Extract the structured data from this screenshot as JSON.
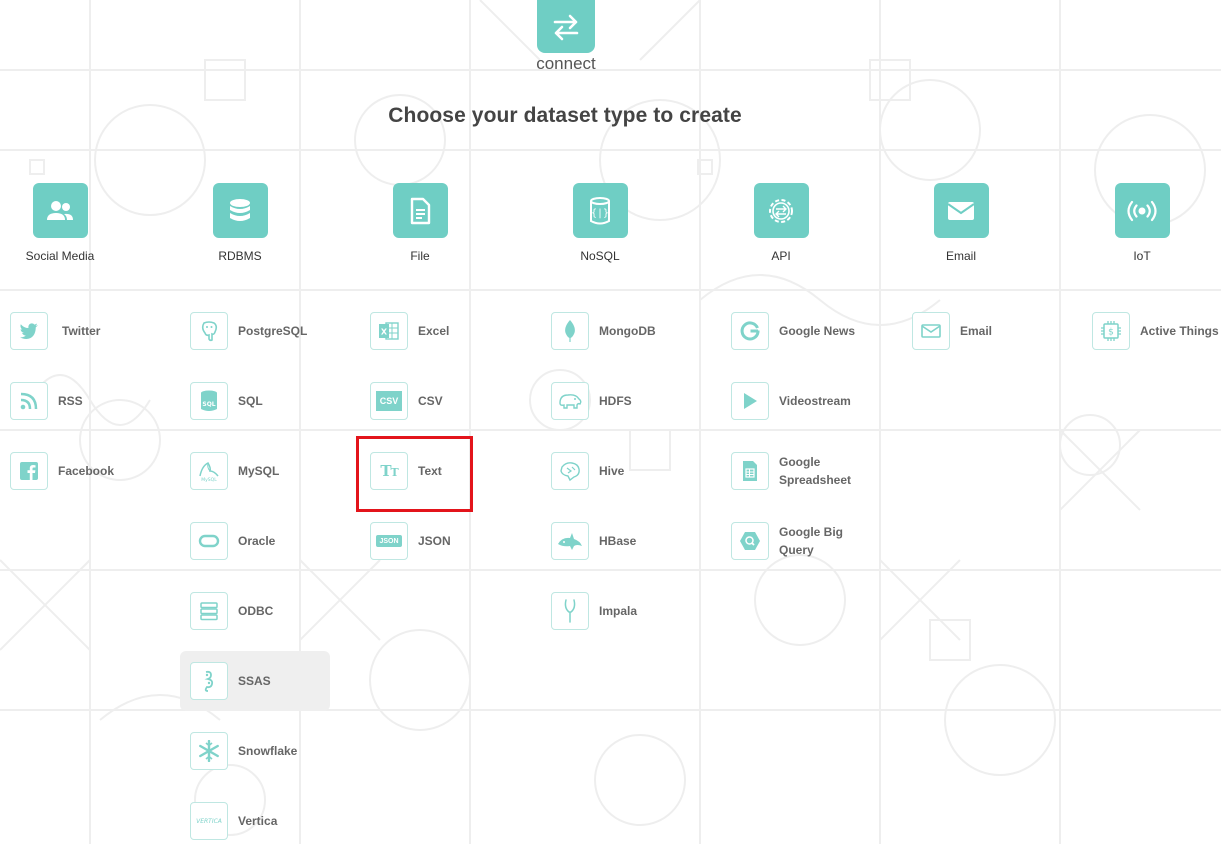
{
  "header": {
    "hero_icon": "swap-arrows-icon",
    "hero_label": "connect",
    "title": "Choose your dataset type to create"
  },
  "colors": {
    "accent": "#6fcec4",
    "highlight": "#e3141b",
    "hover": "#efefef"
  },
  "categories": [
    {
      "label": "Social Media",
      "icon": "people-icon"
    },
    {
      "label": "RDBMS",
      "icon": "database-icon"
    },
    {
      "label": "File",
      "icon": "document-icon"
    },
    {
      "label": "NoSQL",
      "icon": "cylinder-braces-icon"
    },
    {
      "label": "API",
      "icon": "gear-arrows-icon"
    },
    {
      "label": "Email",
      "icon": "envelope-icon"
    },
    {
      "label": "IoT",
      "icon": "broadcast-icon"
    }
  ],
  "columns": {
    "social_media": [
      {
        "label": "Twitter",
        "icon": "twitter-icon"
      },
      {
        "label": "RSS",
        "icon": "rss-icon"
      },
      {
        "label": "Facebook",
        "icon": "facebook-icon"
      }
    ],
    "rdbms": [
      {
        "label": "PostgreSQL",
        "icon": "postgresql-icon"
      },
      {
        "label": "SQL",
        "icon": "sql-icon"
      },
      {
        "label": "MySQL",
        "icon": "mysql-icon"
      },
      {
        "label": "Oracle",
        "icon": "oracle-icon"
      },
      {
        "label": "ODBC",
        "icon": "odbc-icon"
      },
      {
        "label": "SSAS",
        "icon": "ssas-icon"
      },
      {
        "label": "Snowflake",
        "icon": "snowflake-icon"
      },
      {
        "label": "Vertica",
        "icon": "vertica-icon",
        "icon_text": "VERTICA"
      }
    ],
    "file": [
      {
        "label": "Excel",
        "icon": "excel-icon"
      },
      {
        "label": "CSV",
        "icon": "csv-icon",
        "icon_text": "CSV"
      },
      {
        "label": "Text",
        "icon": "text-icon",
        "icon_text": "TT"
      },
      {
        "label": "JSON",
        "icon": "json-icon",
        "icon_text": "JSON"
      }
    ],
    "nosql": [
      {
        "label": "MongoDB",
        "icon": "mongodb-leaf-icon"
      },
      {
        "label": "HDFS",
        "icon": "hdfs-elephant-icon"
      },
      {
        "label": "Hive",
        "icon": "hive-icon"
      },
      {
        "label": "HBase",
        "icon": "hbase-orca-icon"
      },
      {
        "label": "Impala",
        "icon": "impala-icon"
      }
    ],
    "api": [
      {
        "label": "Google News",
        "icon": "google-icon"
      },
      {
        "label": "Videostream",
        "icon": "play-icon"
      },
      {
        "label": "Google Spreadsheet",
        "line1": "Google",
        "line2": "Spreadsheet",
        "icon": "spreadsheet-icon"
      },
      {
        "label": "Google Big Query",
        "line1": "Google Big",
        "line2": "Query",
        "icon": "bigquery-icon"
      }
    ],
    "email": [
      {
        "label": "Email",
        "icon": "envelope-outline-icon"
      }
    ],
    "iot": [
      {
        "label": "Active Things",
        "icon": "chip-icon"
      }
    ]
  }
}
